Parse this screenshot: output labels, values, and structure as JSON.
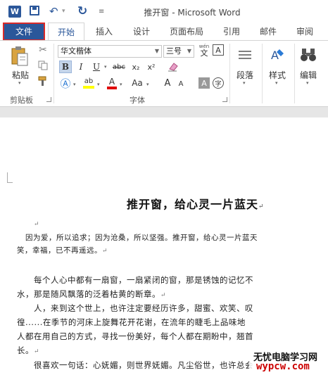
{
  "titlebar": {
    "app_logo": "W",
    "title": "推开窗 - Microsoft Word",
    "icons": {
      "save": "save-icon",
      "undo": "undo-icon",
      "redo": "redo-icon",
      "more": "customize-qat-icon"
    }
  },
  "tabs": {
    "file": "文件",
    "home": "开始",
    "insert": "插入",
    "design": "设计",
    "layout": "页面布局",
    "references": "引用",
    "mailings": "邮件",
    "review": "审阅"
  },
  "ribbon": {
    "clipboard": {
      "paste": "粘贴",
      "label": "剪贴板"
    },
    "font": {
      "font_name": "华文楷体",
      "font_size": "三号",
      "wen_glyph": "wén",
      "bold": "B",
      "italic": "I",
      "underline": "U",
      "strike": "abc",
      "subscript": "x₂",
      "superscript": "x²",
      "grow": "A",
      "shrink": "A",
      "case": "Aa",
      "shade": "A",
      "circle": "字",
      "highlight": "ab",
      "color": "A",
      "label": "字体"
    },
    "paragraph": {
      "label": "段落"
    },
    "styles": {
      "label": "样式"
    },
    "editing": {
      "label": "编辑"
    }
  },
  "document": {
    "paragraph_mark": "↵",
    "title": "推开窗，给心灵一片蓝天",
    "lines": [
      "因为爱，所以追求；因为沧桑，所以坚强。推开窗，给心灵一片蓝天",
      "笑，幸福，已不再遥远。",
      "每个人心中都有一扇窗，一扇紧闭的窗，那是锈蚀的记忆不",
      "水，那是随风飘落的泛着枯黄的断章。",
      "人，来到这个世上，也许注定要经历许多，甜蜜、欢笑、叹",
      "徨......在季节的河床上旋舞花开花谢，在流年的睫毛上品味地",
      "人都在用自己的方式，寻找一份美好，每个人都在期盼中，翘首",
      "长。",
      "很喜欢一句话：心妩媚，则世界妩媚。凡尘俗世，也许总会"
    ]
  },
  "watermark": {
    "line1": "无忧电脑学习网",
    "line2": "wypcw.com"
  },
  "colors": {
    "accent": "#2b579a",
    "file_tab_border": "#d92b2b",
    "highlight_yellow": "#ffff00",
    "font_color_red": "#e00000",
    "watermark_red": "#cc0000"
  }
}
